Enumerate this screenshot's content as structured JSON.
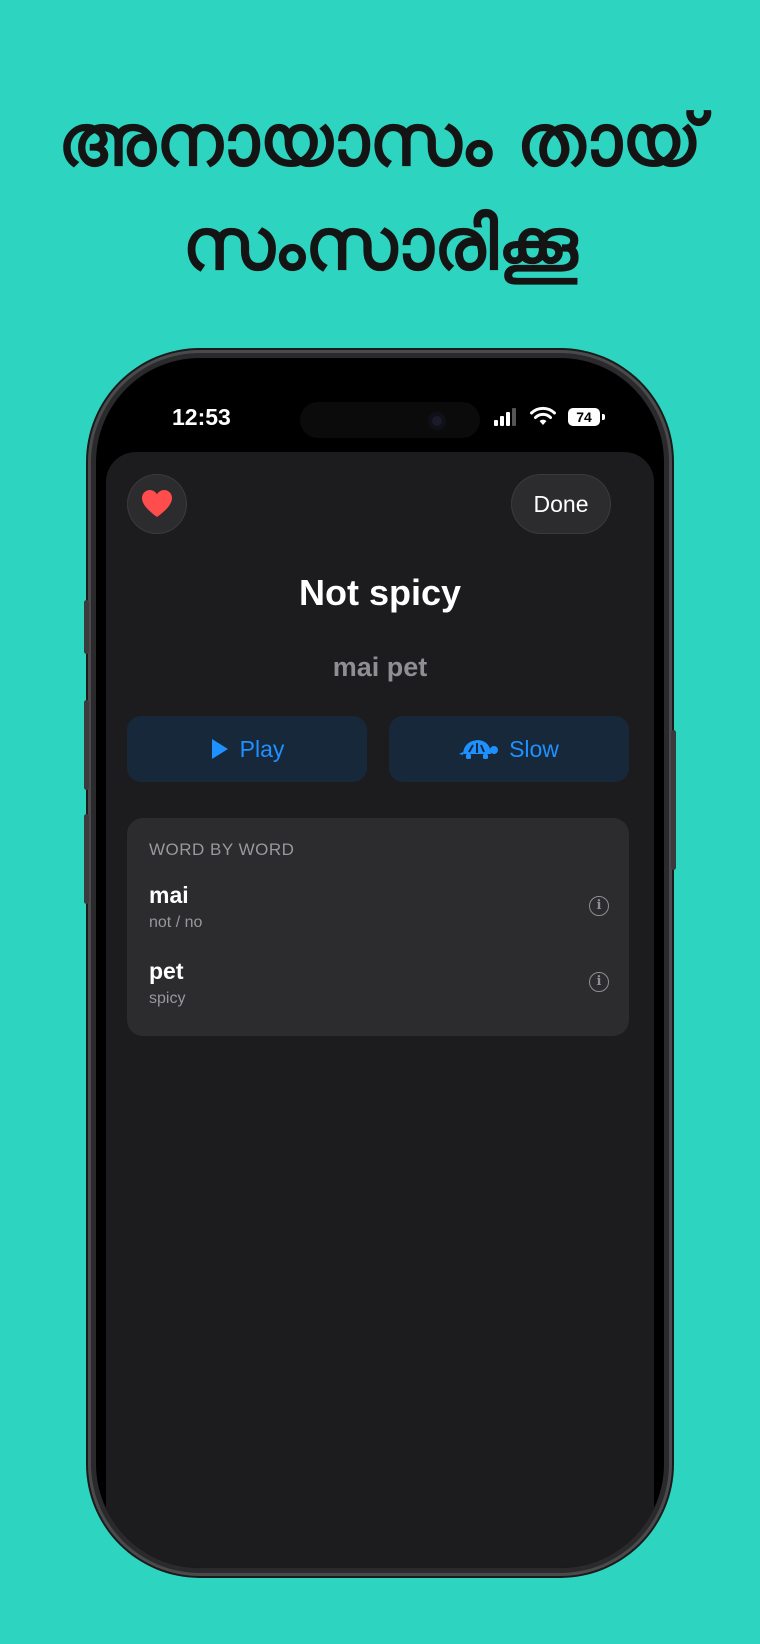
{
  "headline": {
    "line1": "അനായാസം തായ്",
    "line2": "സംസാരിക്കൂ"
  },
  "status_bar": {
    "time": "12:53",
    "battery": "74",
    "icons": [
      "signal-icon",
      "wifi-icon",
      "battery-icon"
    ]
  },
  "sheet": {
    "done_label": "Done",
    "title": "Not spicy",
    "transliteration": "mai pet",
    "play_label": "Play",
    "slow_label": "Slow",
    "favorite_icon": "heart-icon",
    "word_by_word": {
      "header": "WORD BY WORD",
      "items": [
        {
          "word": "mai",
          "meaning": "not / no"
        },
        {
          "word": "pet",
          "meaning": "spicy"
        }
      ]
    }
  },
  "colors": {
    "background": "#2dd4bf",
    "accent": "#1e90ff",
    "heart": "#ff4d4d"
  }
}
